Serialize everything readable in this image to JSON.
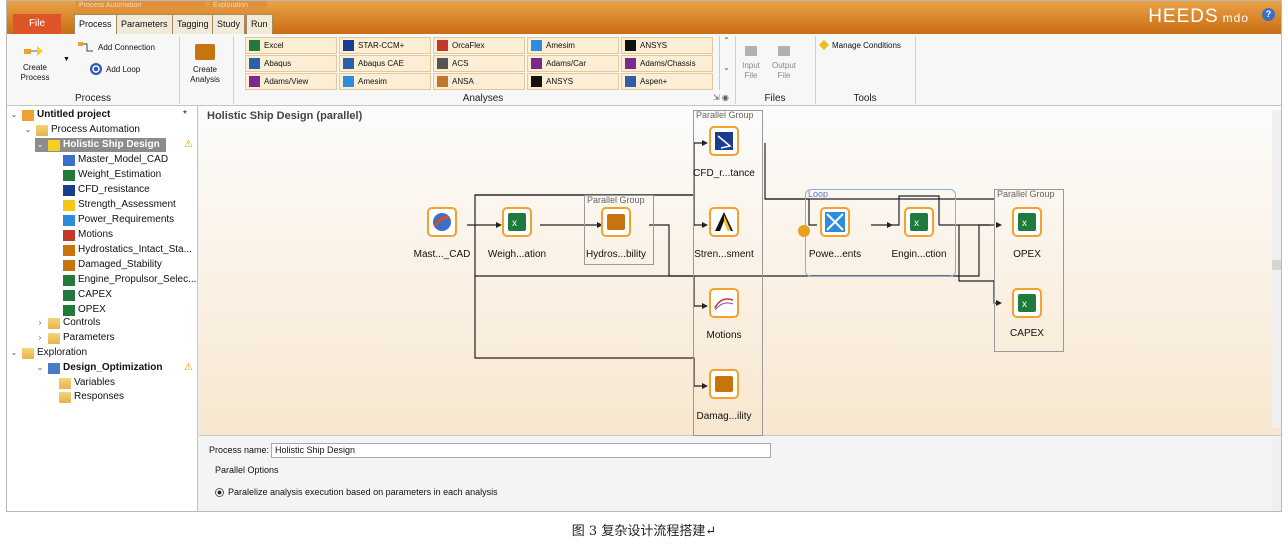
{
  "topbar": {
    "context_tabs": [
      "Process Automation",
      "Exploration"
    ],
    "tabs": [
      "File",
      "Process",
      "Parameters",
      "Tagging",
      "Study",
      "Run"
    ],
    "active_tab": "Process",
    "logo": "HEEDS",
    "logo_sub": "mdo",
    "help": "?"
  },
  "ribbon": {
    "process": {
      "create_process": "Create\nProcess",
      "add_connection": "Add Connection",
      "add_loop": "Add Loop",
      "label": "Process"
    },
    "create_analysis": "Create\nAnalysis",
    "analyses": {
      "items": [
        "Excel",
        "STAR-CCM+",
        "OrcaFlex",
        "Amesim",
        "ANSYS",
        "Abaqus",
        "Abaqus CAE",
        "ACS",
        "Adams/Car",
        "Adams/Chassis",
        "Adams/View",
        "Amesim",
        "ANSA",
        "ANSYS",
        "Aspen+"
      ],
      "label": "Analyses"
    },
    "files": {
      "input": "Input\nFile",
      "output": "Output\nFile",
      "label": "Files"
    },
    "tools": {
      "manage": "Manage Conditions",
      "label": "Tools"
    }
  },
  "tree": {
    "project": "Untitled project",
    "project_mark": "*",
    "process_automation": "Process Automation",
    "holistic": "Holistic Ship Design",
    "analyses": [
      "Master_Model_CAD",
      "Weight_Estimation",
      "CFD_resistance",
      "Strength_Assessment",
      "Power_Requirements",
      "Motions",
      "Hydrostatics_Intact_Sta...",
      "Damaged_Stability",
      "Engine_Propulsor_Selec...",
      "CAPEX",
      "OPEX"
    ],
    "controls": "Controls",
    "parameters": "Parameters",
    "exploration": "Exploration",
    "design_opt": "Design_Optimization",
    "variables": "Variables",
    "responses": "Responses"
  },
  "canvas": {
    "title": "Holistic Ship Design (parallel)",
    "group_label": "Parallel Group",
    "loop_label": "Loop",
    "nodes": {
      "master": "Mast..._CAD",
      "weight": "Weigh...ation",
      "hydro": "Hydros...bility",
      "cfd": "CFD_r...tance",
      "strength": "Stren...sment",
      "motions": "Motions",
      "damaged": "Damag...ility",
      "power": "Powe...ents",
      "engine": "Engin...ction",
      "opex": "OPEX",
      "capex": "CAPEX"
    }
  },
  "props": {
    "process_name_label": "Process name:",
    "process_name_value": "Holistic Ship Design",
    "parallel_options": "Parallel Options",
    "option1": "Paralelize analysis execution based on parameters in each analysis"
  },
  "caption": "图 3   复杂设计流程搭建↵",
  "colors": {
    "accent": "#f4a12d",
    "excel": "#1f7a3c",
    "topbar": "#d47a1f"
  }
}
